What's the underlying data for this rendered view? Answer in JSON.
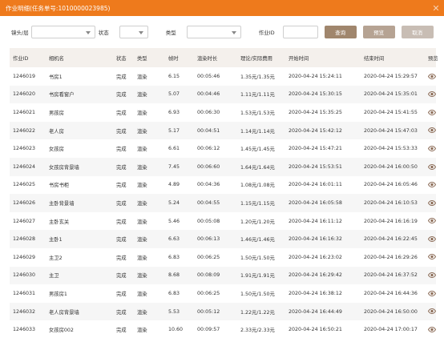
{
  "dialog": {
    "title": "作业明细(任务单号:1010000023985)",
    "close_icon": "close-icon"
  },
  "filters": {
    "lens_label": "镜头/层",
    "status_label": "状态",
    "type_label": "类型",
    "job_id_label": "作业ID",
    "lens_value": "",
    "status_value": "",
    "type_value": "",
    "job_id_value": "",
    "query_label": "查询",
    "preview_label": "预览",
    "cancel_label": "取消"
  },
  "colors": {
    "titlebar": "#ee7a1c",
    "query_button": "#a0866d",
    "preview_button": "#b6a393",
    "cancel_button": "#c8bdb4",
    "eye_icon": "#8a6a55"
  },
  "table": {
    "headers": [
      "作业ID",
      "相机名",
      "状态",
      "类型",
      "帧时",
      "渲染时长",
      "理论/实际费用",
      "开始时间",
      "结束时间",
      "预览"
    ],
    "rows": [
      [
        "1246019",
        "书房1",
        "完成",
        "渲染",
        "6.15",
        "00:05:46",
        "1.35元/1.35元",
        "2020-04-24 15:24:11",
        "2020-04-24 15:29:57",
        "eye-icon"
      ],
      [
        "1246020",
        "书房看窗户",
        "完成",
        "渲染",
        "5.07",
        "00:04:46",
        "1.11元/1.11元",
        "2020-04-24 15:30:15",
        "2020-04-24 15:35:01",
        "eye-icon"
      ],
      [
        "1246021",
        "男孩房",
        "完成",
        "渲染",
        "6.93",
        "00:06:30",
        "1.53元/1.53元",
        "2020-04-24 15:35:25",
        "2020-04-24 15:41:55",
        "eye-icon"
      ],
      [
        "1246022",
        "老人房",
        "完成",
        "渲染",
        "5.17",
        "00:04:51",
        "1.14元/1.14元",
        "2020-04-24 15:42:12",
        "2020-04-24 15:47:03",
        "eye-icon"
      ],
      [
        "1246023",
        "女孩房",
        "完成",
        "渲染",
        "6.61",
        "00:06:12",
        "1.45元/1.45元",
        "2020-04-24 15:47:21",
        "2020-04-24 15:53:33",
        "eye-icon"
      ],
      [
        "1246024",
        "女孩房背景墙",
        "完成",
        "渲染",
        "7.45",
        "00:06:60",
        "1.64元/1.64元",
        "2020-04-24 15:53:51",
        "2020-04-24 16:00:50",
        "eye-icon"
      ],
      [
        "1246025",
        "书房书柜",
        "完成",
        "渲染",
        "4.89",
        "00:04:36",
        "1.08元/1.08元",
        "2020-04-24 16:01:11",
        "2020-04-24 16:05:46",
        "eye-icon"
      ],
      [
        "1246026",
        "主卧背景墙",
        "完成",
        "渲染",
        "5.24",
        "00:04:55",
        "1.15元/1.15元",
        "2020-04-24 16:05:58",
        "2020-04-24 16:10:53",
        "eye-icon"
      ],
      [
        "1246027",
        "主卧玄关",
        "完成",
        "渲染",
        "5.46",
        "00:05:08",
        "1.20元/1.20元",
        "2020-04-24 16:11:12",
        "2020-04-24 16:16:19",
        "eye-icon"
      ],
      [
        "1246028",
        "主卧1",
        "完成",
        "渲染",
        "6.63",
        "00:06:13",
        "1.46元/1.46元",
        "2020-04-24 16:16:32",
        "2020-04-24 16:22:45",
        "eye-icon"
      ],
      [
        "1246029",
        "主卫2",
        "完成",
        "渲染",
        "6.83",
        "00:06:25",
        "1.50元/1.50元",
        "2020-04-24 16:23:02",
        "2020-04-24 16:29:26",
        "eye-icon"
      ],
      [
        "1246030",
        "主卫",
        "完成",
        "渲染",
        "8.68",
        "00:08:09",
        "1.91元/1.91元",
        "2020-04-24 16:29:42",
        "2020-04-24 16:37:52",
        "eye-icon"
      ],
      [
        "1246031",
        "男孩房1",
        "完成",
        "渲染",
        "6.83",
        "00:06:25",
        "1.50元/1.50元",
        "2020-04-24 16:38:12",
        "2020-04-24 16:44:36",
        "eye-icon"
      ],
      [
        "1246032",
        "老人房背景墙",
        "完成",
        "渲染",
        "5.53",
        "00:05:12",
        "1.22元/1.22元",
        "2020-04-24 16:44:49",
        "2020-04-24 16:50:00",
        "eye-icon"
      ],
      [
        "1246033",
        "女孩房002",
        "完成",
        "渲染",
        "10.60",
        "00:09:57",
        "2.33元/2.33元",
        "2020-04-24 16:50:21",
        "2020-04-24 17:00:17",
        "eye-icon"
      ]
    ]
  }
}
